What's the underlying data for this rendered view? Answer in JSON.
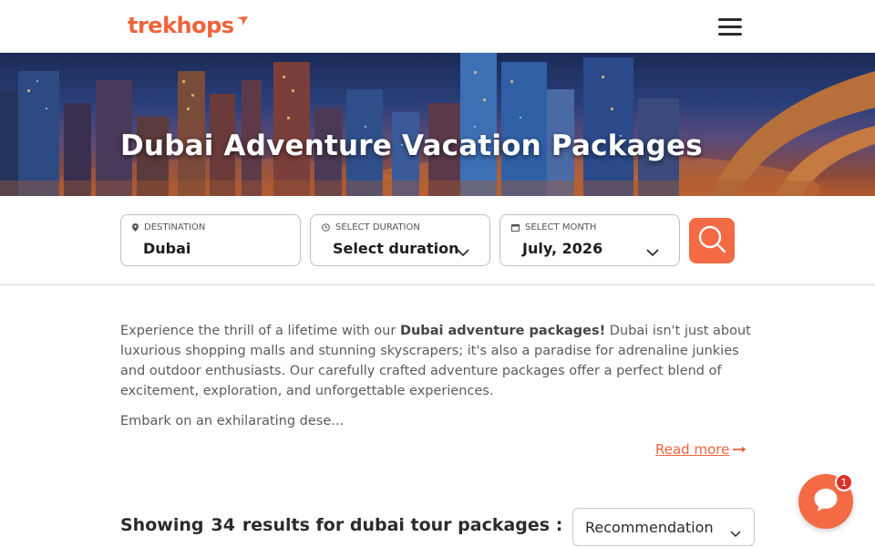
{
  "header": {
    "logo_text": "trekhops",
    "brand_color": "#f0633a",
    "menu_icon": "hamburger-menu-icon"
  },
  "hero": {
    "title": "Dubai Adventure Vacation Packages"
  },
  "search": {
    "destination": {
      "label": "DESTINATION",
      "value": "Dubai",
      "icon": "map-pin-icon"
    },
    "duration": {
      "label": "SELECT DURATION",
      "value": "Select duration",
      "icon": "clock-icon"
    },
    "month": {
      "label": "SELECT MONTH",
      "value": "July, 2026",
      "icon": "calendar-icon"
    },
    "search_icon": "search-icon",
    "button_color": "#f36a45"
  },
  "description": {
    "intro": "Experience the thrill of a lifetime with our ",
    "highlight": "Dubai adventure packages!",
    "body": " Dubai isn't just about luxurious shopping malls and stunning skyscrapers; it's also a paradise for adrenaline junkies and outdoor enthusiasts. Our carefully crafted adventure packages offer a perfect blend of excitement, exploration, and unforgettable experiences.",
    "paragraph2": "Embark on an exhilarating dese...",
    "read_more": "Read more"
  },
  "results": {
    "prefix": "Showing",
    "count": "34",
    "suffix": "results for dubai tour packages :",
    "sort_value": "Recommendation"
  },
  "chat": {
    "badge": "1",
    "icon": "chat-bubble-icon"
  }
}
